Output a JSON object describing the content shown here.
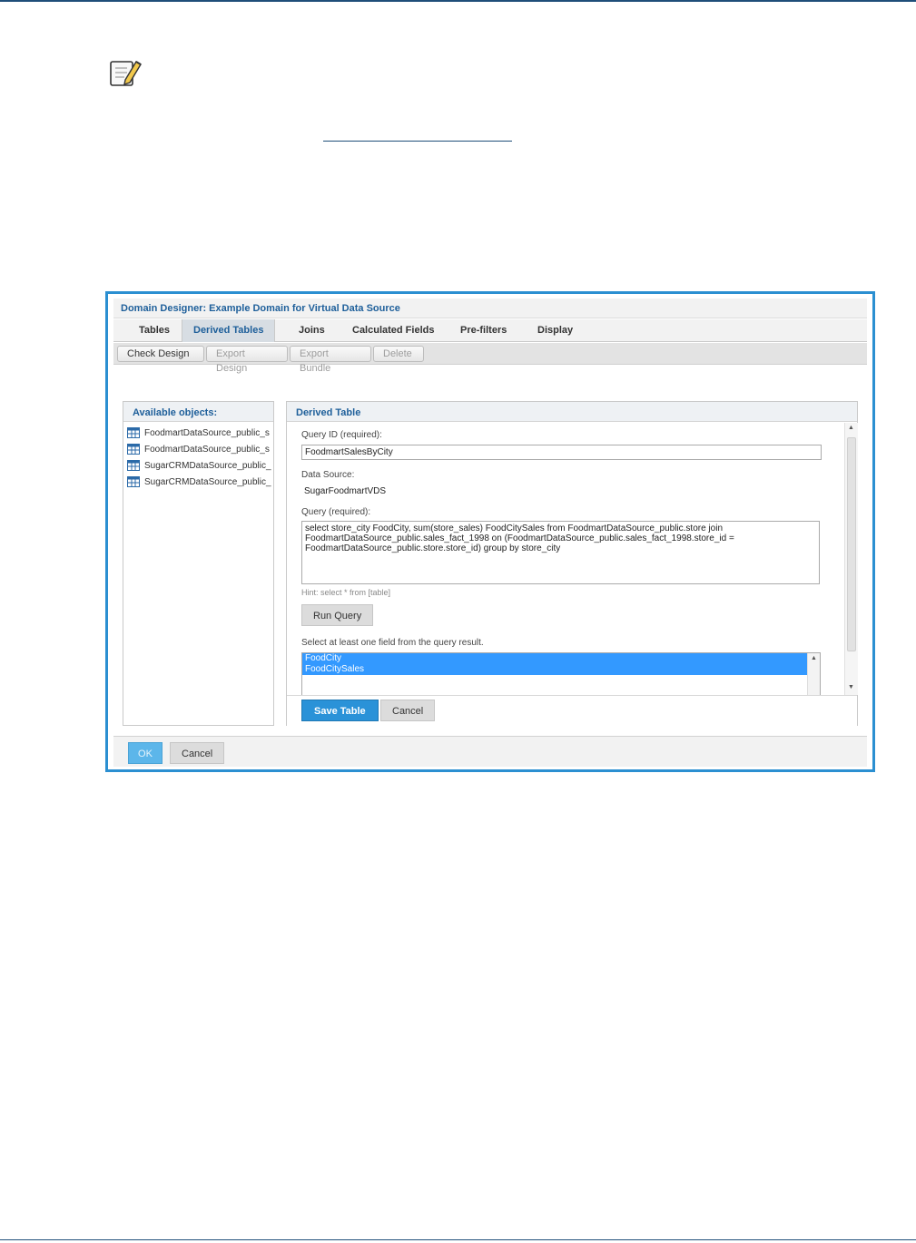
{
  "window": {
    "title": "Domain Designer: Example Domain for Virtual Data Source"
  },
  "tabs": [
    {
      "label": "Tables"
    },
    {
      "label": "Derived Tables"
    },
    {
      "label": "Joins"
    },
    {
      "label": "Calculated Fields"
    },
    {
      "label": "Pre-filters"
    },
    {
      "label": "Display"
    }
  ],
  "active_tab": "Derived Tables",
  "toolbar": {
    "check_design": "Check Design",
    "export_design": "Export Design",
    "export_bundle": "Export Bundle",
    "delete": "Delete"
  },
  "available": {
    "heading": "Available objects:",
    "items": [
      {
        "label": "FoodmartDataSource_public_s"
      },
      {
        "label": "FoodmartDataSource_public_s"
      },
      {
        "label": "SugarCRMDataSource_public_"
      },
      {
        "label": "SugarCRMDataSource_public_"
      }
    ]
  },
  "derived": {
    "heading": "Derived Table",
    "query_id_label": "Query ID (required):",
    "query_id_value": "FoodmartSalesByCity",
    "data_source_label": "Data Source:",
    "data_source_value": "SugarFoodmartVDS",
    "query_label": "Query (required):",
    "query_value": "select store_city FoodCity, sum(store_sales) FoodCitySales from FoodmartDataSource_public.store join FoodmartDataSource_public.sales_fact_1998 on (FoodmartDataSource_public.sales_fact_1998.store_id = FoodmartDataSource_public.store.store_id) group by store_city",
    "hint": "Hint: select * from [table]",
    "run_query": "Run Query",
    "select_instruction": "Select at least one field from the query result.",
    "fields": [
      {
        "label": "FoodCity"
      },
      {
        "label": "FoodCitySales"
      }
    ],
    "save_table": "Save Table",
    "cancel": "Cancel"
  },
  "footer": {
    "ok": "OK",
    "cancel": "Cancel"
  },
  "colors": {
    "accent": "#2b8fd1",
    "heading_text": "#1e5f9a",
    "selection": "#3399ff"
  }
}
